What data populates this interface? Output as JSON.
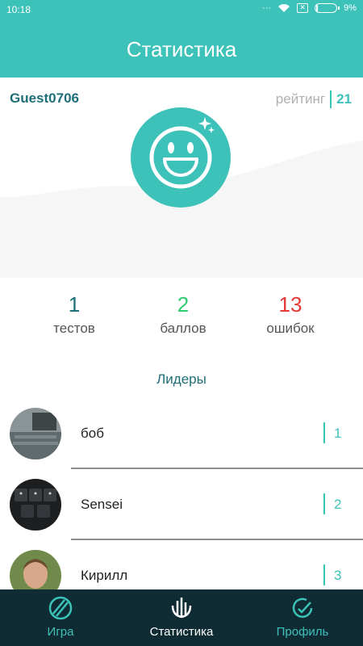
{
  "status_bar": {
    "time": "10:18",
    "battery": "9%",
    "battery_level": 0.09
  },
  "header": {
    "title": "Статистика"
  },
  "profile": {
    "username": "Guest0706",
    "rating_label": "рейтинг",
    "rating_value": "21"
  },
  "stats": [
    {
      "value": "1",
      "label": "тестов",
      "color": "#1e6e78"
    },
    {
      "value": "2",
      "label": "баллов",
      "color": "#2ecc71"
    },
    {
      "value": "13",
      "label": "ошибок",
      "color": "#e53935"
    }
  ],
  "leaders": {
    "title": "Лидеры",
    "items": [
      {
        "name": "боб",
        "rank": "1"
      },
      {
        "name": "Sensei",
        "rank": "2"
      },
      {
        "name": "Кирилл",
        "rank": "3"
      }
    ]
  },
  "nav": {
    "items": [
      {
        "label": "Игра",
        "icon": "ball-icon",
        "active": false
      },
      {
        "label": "Статистика",
        "icon": "stats-icon",
        "active": true
      },
      {
        "label": "Профиль",
        "icon": "profile-icon",
        "active": false
      }
    ]
  },
  "colors": {
    "accent": "#3cc2b9",
    "dark": "#1e6e78",
    "nav_bg": "#0f2b33"
  }
}
